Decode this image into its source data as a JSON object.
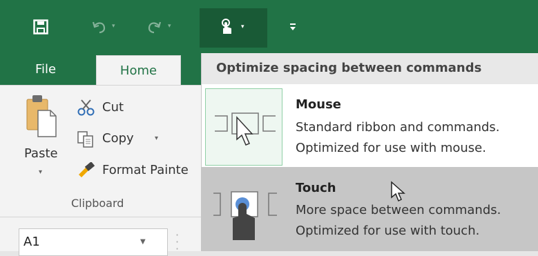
{
  "colors": {
    "excel_green": "#217346",
    "menu_selected": "#c6c6c6",
    "header_bg": "#e8e8e8"
  },
  "tabs": {
    "file": "File",
    "home": "Home"
  },
  "ribbon": {
    "paste_label": "Paste",
    "cut_label": "Cut",
    "copy_label": "Copy",
    "format_painter_label": "Format Painte",
    "group_label": "Clipboard"
  },
  "namebox": {
    "value": "A1"
  },
  "menu": {
    "header": "Optimize spacing between commands",
    "items": [
      {
        "title": "Mouse",
        "line1": "Standard ribbon and commands.",
        "line2": "Optimized for use with mouse.",
        "icon": "mouse-mode-icon"
      },
      {
        "title": "Touch",
        "line1": "More space between commands.",
        "line2": "Optimized for use with touch.",
        "icon": "touch-mode-icon"
      }
    ]
  },
  "icons": [
    "save-icon",
    "undo-icon",
    "redo-icon",
    "touch-mode-icon",
    "customize-qat-icon",
    "paste-icon",
    "cut-icon",
    "copy-icon",
    "format-painter-icon"
  ]
}
